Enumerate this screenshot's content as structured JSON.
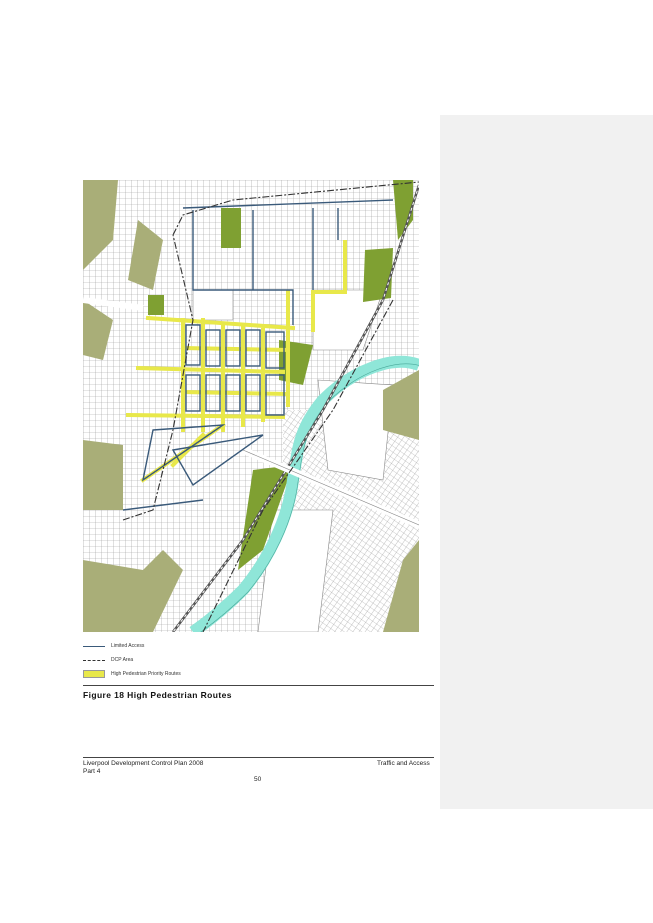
{
  "legend": {
    "items": [
      {
        "label": "Limited Access",
        "symbol": "solid-line",
        "color": "#3a5a7a"
      },
      {
        "label": "DCP Area",
        "symbol": "dashed-line",
        "color": "#333333"
      },
      {
        "label": "High Pedestrian Priority Routes",
        "symbol": "fill-box",
        "color": "#e8e84a"
      }
    ]
  },
  "figure": {
    "caption": "Figure 18  High Pedestrian Routes"
  },
  "footer": {
    "left_line1": "Liverpool Development Control Plan 2008",
    "left_line2": "Part 4",
    "right": "Traffic and Access",
    "page_number": "50"
  },
  "colors": {
    "park": "#a9ae78",
    "park_dark": "#7fa032",
    "river": "#8fe6d8",
    "pedestrian_route": "#e8e84a",
    "limited_access": "#3a5a7a"
  }
}
